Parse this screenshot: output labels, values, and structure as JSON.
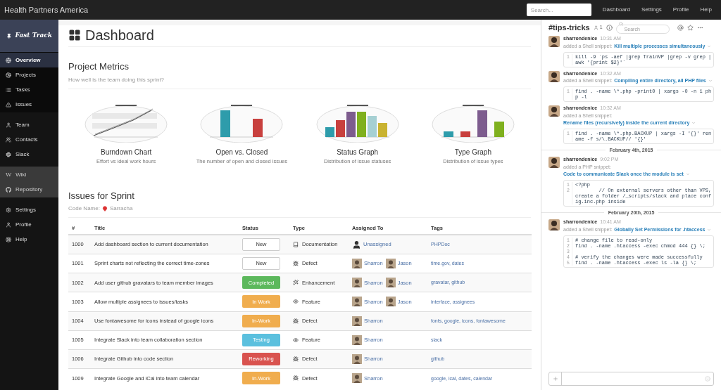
{
  "topbar": {
    "title": "Health Partners America",
    "search": {
      "placeholder": "Search..."
    },
    "links": [
      "Dashboard",
      "Settings",
      "Profile",
      "Help"
    ]
  },
  "sidebar": {
    "brand": "Fast Track",
    "groups": [
      {
        "items": [
          {
            "label": "Overview",
            "selected": true
          },
          {
            "label": "Projects",
            "selected": false
          },
          {
            "label": "Tasks",
            "selected": false
          },
          {
            "label": "Issues",
            "selected": false
          }
        ]
      },
      {
        "items": [
          {
            "label": "Team",
            "selected": false
          },
          {
            "label": "Contacts",
            "selected": false
          },
          {
            "label": "Slack",
            "selected": false
          }
        ]
      },
      {
        "items": [
          {
            "label": "Wiki",
            "glyph": "W",
            "selected": false
          },
          {
            "label": "Repository",
            "selected": false
          }
        ]
      },
      {
        "items": [
          {
            "label": "Settings",
            "selected": false
          },
          {
            "label": "Profile",
            "selected": false
          },
          {
            "label": "Help",
            "selected": false
          }
        ]
      }
    ]
  },
  "page": {
    "title": "Dashboard"
  },
  "metrics": {
    "title": "Project Metrics",
    "subtitle": "How well is the team doing this sprint?",
    "charts": [
      {
        "kind": "burndown",
        "title": "Burndown Chart",
        "caption": "Effort vs ideal work hours"
      },
      {
        "kind": "open_closed",
        "title": "Open vs. Closed",
        "caption": "The number of open and closed issues"
      },
      {
        "kind": "statuses",
        "title": "Status Graph",
        "caption": "Distribution of issue statuses"
      },
      {
        "kind": "types",
        "title": "Type Graph",
        "caption": "Distribution of issue types"
      }
    ]
  },
  "issues": {
    "title": "Issues for Sprint",
    "code_name_label": "Code Name:",
    "code_name": "Sarracha",
    "columns": [
      "#",
      "Title",
      "Status",
      "Type",
      "Assigned To",
      "Tags"
    ],
    "rows": [
      {
        "id": "1000",
        "title": "Add dashboard section to current documentation",
        "status": {
          "label": "New",
          "kind": "default"
        },
        "type": {
          "label": "Documentation",
          "kind": "documentation"
        },
        "assignees": [
          {
            "name": "Unassigned",
            "kind": "unassigned"
          }
        ],
        "tags": "PHPDoc"
      },
      {
        "id": "1001",
        "title": "Sprint charts not reflecting the correct time-zones",
        "status": {
          "label": "New",
          "kind": "default"
        },
        "type": {
          "label": "Defect",
          "kind": "defect"
        },
        "assignees": [
          {
            "name": "Sharron",
            "kind": "person"
          },
          {
            "name": "Jason",
            "kind": "person"
          }
        ],
        "tags": "time.gov, dates"
      },
      {
        "id": "1002",
        "title": "Add user github gravatars to team member images",
        "status": {
          "label": "Completed",
          "kind": "success"
        },
        "type": {
          "label": "Enhancement",
          "kind": "enhancement"
        },
        "assignees": [
          {
            "name": "Sharron",
            "kind": "person"
          },
          {
            "name": "Jason",
            "kind": "person"
          }
        ],
        "tags": "gravatar, github"
      },
      {
        "id": "1003",
        "title": "Allow multiple assignees to issues/tasks",
        "status": {
          "label": "In Work",
          "kind": "warning"
        },
        "type": {
          "label": "Feature",
          "kind": "feature"
        },
        "assignees": [
          {
            "name": "Sharron",
            "kind": "person"
          },
          {
            "name": "Jason",
            "kind": "person"
          }
        ],
        "tags": "interface, assignees"
      },
      {
        "id": "1004",
        "title": "Use fontawesome for icons instead of google icons",
        "status": {
          "label": "In-Work",
          "kind": "warning"
        },
        "type": {
          "label": "Defect",
          "kind": "defect"
        },
        "assignees": [
          {
            "name": "Sharron",
            "kind": "person"
          }
        ],
        "tags": "fonts, google, icons, fontawesome"
      },
      {
        "id": "1005",
        "title": "Integrate Slack into team collaboration section",
        "status": {
          "label": "Testing",
          "kind": "info"
        },
        "type": {
          "label": "Feature",
          "kind": "feature"
        },
        "assignees": [
          {
            "name": "Sharron",
            "kind": "person"
          }
        ],
        "tags": "slack"
      },
      {
        "id": "1006",
        "title": "Integrate Github into code section",
        "status": {
          "label": "Reworking",
          "kind": "danger"
        },
        "type": {
          "label": "Defect",
          "kind": "defect"
        },
        "assignees": [
          {
            "name": "Sharron",
            "kind": "person"
          }
        ],
        "tags": "github"
      },
      {
        "id": "1009",
        "title": "Integrate Google and iCal into team calendar",
        "status": {
          "label": "In-Work",
          "kind": "warning"
        },
        "type": {
          "label": "Defect",
          "kind": "defect"
        },
        "assignees": [
          {
            "name": "Sharron",
            "kind": "person"
          }
        ],
        "tags": "google, ical, dates, calendar"
      }
    ]
  },
  "slack": {
    "channel": "#tips-tricks",
    "members": "1",
    "search": {
      "placeholder": "Search"
    },
    "feed": [
      {
        "kind": "message",
        "user": "sharrondenice",
        "time": "10:31 AM",
        "action": "added a Shell snippet:",
        "snippet_title": "Kill multiple processes simultaneously",
        "code": [
          {
            "n": "1",
            "text": "kill -9 `ps -aef |grep TrainVP |grep -v grep |awk '{print $2}'`"
          }
        ]
      },
      {
        "kind": "message",
        "user": "sharrondenice",
        "time": "10:32 AM",
        "action": "added a Shell snippet:",
        "snippet_title": "Compiling entire directory, all PHP files",
        "code": [
          {
            "n": "1",
            "text": "find . -name \\*.php -print0 | xargs -0 -n 1 php -l"
          }
        ]
      },
      {
        "kind": "message",
        "user": "sharrondenice",
        "time": "10:32 AM",
        "action": "added a Shell snippet:",
        "snippet_title": "Rename files (recursively) inside the current directory",
        "code": [
          {
            "n": "1",
            "text": "find . -name \\*.php.BACKUP | xargs -I '{}' rename -f s/\\.BACKUP// '{}'"
          }
        ]
      },
      {
        "kind": "divider",
        "label": "February 4th, 2015"
      },
      {
        "kind": "message",
        "user": "sharrondenice",
        "time": "9:02 PM",
        "action": "added a PHP snippet:",
        "snippet_title": "Code to communicate Slack once the module is set",
        "code": [
          {
            "n": "1",
            "text": "<?php"
          },
          {
            "n": "2",
            "text": "        // On external servers other than VPS, create a folder /_scripts/slack and place config.inc.php inside"
          }
        ]
      },
      {
        "kind": "divider",
        "label": "February 20th, 2015"
      },
      {
        "kind": "message",
        "user": "sharrondenice",
        "time": "10:41 AM",
        "action": "added a Shell snippet:",
        "snippet_title": "Globally Set Permissions for .htaccess",
        "code": [
          {
            "n": "1",
            "text": "# change file to read-only"
          },
          {
            "n": "2",
            "text": "find . -name .htaccess -exec chmod 444 {} \\;"
          },
          {
            "n": "3"
          },
          {
            "n": "4",
            "text": "# verify the changes were made successfully"
          },
          {
            "n": "5",
            "text": "find . -name .htaccess -exec ls -la {} \\;"
          }
        ]
      }
    ]
  }
}
